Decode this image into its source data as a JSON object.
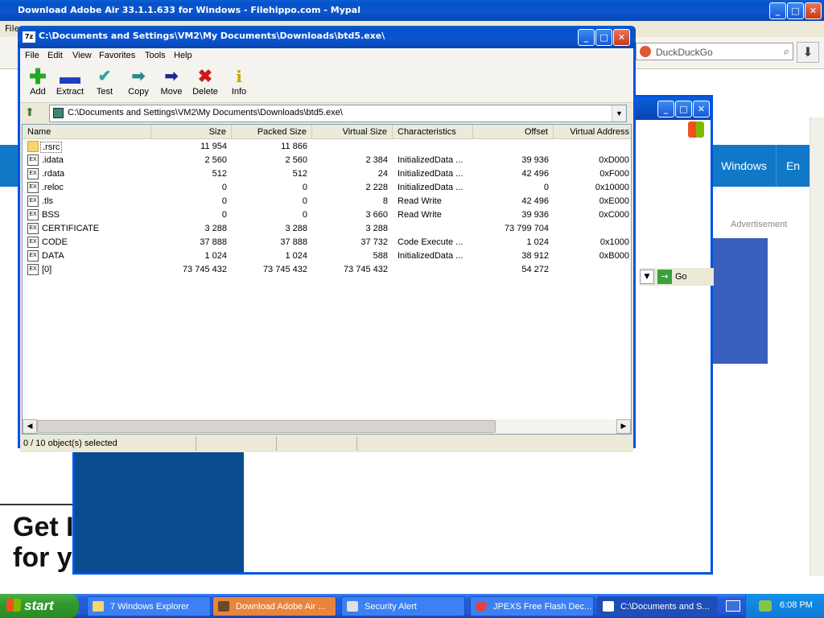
{
  "browser": {
    "title": "Download Adobe Air 33.1.1.633 for Windows - Filehippo.com - Mypal",
    "menu_partial": "File",
    "search_placeholder": "DuckDuckGo",
    "nav_items": [
      "Windows",
      "En"
    ],
    "advertisement_label": "Advertisement",
    "get_text_line1": "Get I",
    "get_text_line2": "for y"
  },
  "sevenzip": {
    "title": "C:\\Documents and Settings\\VM2\\My Documents\\Downloads\\btd5.exe\\",
    "menu": [
      "File",
      "Edit",
      "View",
      "Favorites",
      "Tools",
      "Help"
    ],
    "toolbar": [
      {
        "label": "Add",
        "icon": "plus-icon",
        "color": "#22aa22"
      },
      {
        "label": "Extract",
        "icon": "minus-icon",
        "color": "#1c3fbf"
      },
      {
        "label": "Test",
        "icon": "check-icon",
        "color": "#2aa6a6"
      },
      {
        "label": "Copy",
        "icon": "copy-arrow-icon",
        "color": "#2a8a8a"
      },
      {
        "label": "Move",
        "icon": "move-arrow-icon",
        "color": "#1c2a8f"
      },
      {
        "label": "Delete",
        "icon": "delete-x-icon",
        "color": "#d11818"
      },
      {
        "label": "Info",
        "icon": "info-icon",
        "color": "#c9a500"
      }
    ],
    "address": "C:\\Documents and Settings\\VM2\\My Documents\\Downloads\\btd5.exe\\",
    "columns": [
      "Name",
      "Size",
      "Packed Size",
      "Virtual Size",
      "Characteristics",
      "Offset",
      "Virtual Address"
    ],
    "rows": [
      {
        "name": ".rsrc",
        "size": "11 954",
        "packed": "11 866",
        "virtual": "",
        "chars": "",
        "offset": "",
        "vaddr": "",
        "folder": true
      },
      {
        "name": ".idata",
        "size": "2 560",
        "packed": "2 560",
        "virtual": "2 384",
        "chars": "InitializedData ...",
        "offset": "39 936",
        "vaddr": "0xD000"
      },
      {
        "name": ".rdata",
        "size": "512",
        "packed": "512",
        "virtual": "24",
        "chars": "InitializedData ...",
        "offset": "42 496",
        "vaddr": "0xF000"
      },
      {
        "name": ".reloc",
        "size": "0",
        "packed": "0",
        "virtual": "2 228",
        "chars": "InitializedData ...",
        "offset": "0",
        "vaddr": "0x10000"
      },
      {
        "name": ".tls",
        "size": "0",
        "packed": "0",
        "virtual": "8",
        "chars": "Read Write",
        "offset": "42 496",
        "vaddr": "0xE000"
      },
      {
        "name": "BSS",
        "size": "0",
        "packed": "0",
        "virtual": "3 660",
        "chars": "Read Write",
        "offset": "39 936",
        "vaddr": "0xC000"
      },
      {
        "name": "CERTIFICATE",
        "size": "3 288",
        "packed": "3 288",
        "virtual": "3 288",
        "chars": "",
        "offset": "73 799 704",
        "vaddr": ""
      },
      {
        "name": "CODE",
        "size": "37 888",
        "packed": "37 888",
        "virtual": "37 732",
        "chars": "Code Execute ...",
        "offset": "1 024",
        "vaddr": "0x1000"
      },
      {
        "name": "DATA",
        "size": "1 024",
        "packed": "1 024",
        "virtual": "588",
        "chars": "InitializedData ...",
        "offset": "38 912",
        "vaddr": "0xB000"
      },
      {
        "name": "[0]",
        "size": "73 745 432",
        "packed": "73 745 432",
        "virtual": "73 745 432",
        "chars": "",
        "offset": "54 272",
        "vaddr": ""
      }
    ],
    "status": "0 / 10 object(s) selected"
  },
  "taskbar": {
    "start": "start",
    "tasks": [
      {
        "label": "7 Windows Explorer"
      },
      {
        "label": "Download Adobe Air ..."
      },
      {
        "label": "Security Alert"
      },
      {
        "label": "JPEXS Free Flash Dec..."
      },
      {
        "label": "C:\\Documents and S..."
      }
    ],
    "clock": "6:08 PM"
  },
  "ie_go_label": "Go"
}
